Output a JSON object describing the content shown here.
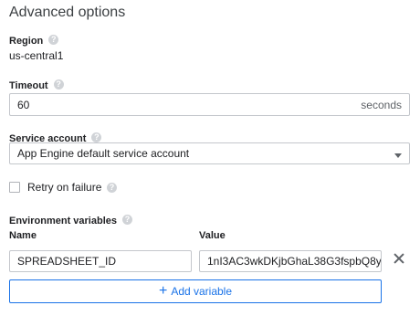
{
  "section_title": "Advanced options",
  "region": {
    "label": "Region",
    "value": "us-central1"
  },
  "timeout": {
    "label": "Timeout",
    "value": "60",
    "suffix": "seconds"
  },
  "service_account": {
    "label": "Service account",
    "selected": "App Engine default service account"
  },
  "retry": {
    "label": "Retry on failure",
    "checked": false
  },
  "env_vars": {
    "label": "Environment variables",
    "col_name": "Name",
    "col_value": "Value",
    "rows": [
      {
        "name": "SPREADSHEET_ID",
        "value": "1nI3AC3wkDKjbGhaL38G3fspbQ8y"
      }
    ],
    "add_label": "Add variable"
  },
  "icons": {
    "help": "help-circle-icon",
    "dropdown": "chevron-down-icon",
    "remove": "close-icon",
    "add": "plus-icon"
  },
  "colors": {
    "accent": "#1a73e8",
    "border": "#c4c7cc"
  }
}
